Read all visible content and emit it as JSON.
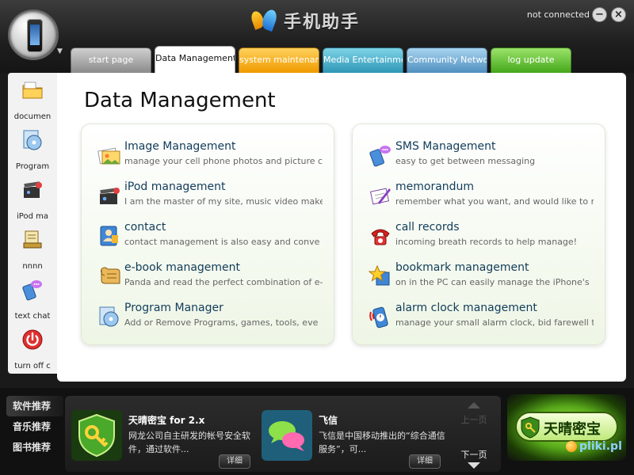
{
  "header": {
    "app_title": "手机助手",
    "connection_status": "not connected",
    "minimize_label": "−",
    "close_label": "×"
  },
  "tabs": [
    {
      "label": "start page"
    },
    {
      "label": "Data Management"
    },
    {
      "label": "system maintenance"
    },
    {
      "label": "Media Entertainment"
    },
    {
      "label": "Community Network"
    },
    {
      "label": "log update"
    }
  ],
  "sidebar": {
    "items": [
      {
        "label": "documen",
        "icon": "folder-icon"
      },
      {
        "label": "Program",
        "icon": "program-disc-icon"
      },
      {
        "label": "iPod ma",
        "icon": "clapperboard-icon"
      },
      {
        "label": "nnnn",
        "icon": "book-stack-icon"
      },
      {
        "label": "text chat",
        "icon": "chat-bubble-icon"
      },
      {
        "label": "turn off c",
        "icon": "power-icon"
      }
    ]
  },
  "main": {
    "title": "Data Management",
    "left_group": [
      {
        "title": "Image Management",
        "desc": "manage your cell phone photos and picture c",
        "icon": "photos-icon"
      },
      {
        "title": "iPod management",
        "desc": "I am the master of my site, music video make",
        "icon": "clapperboard-icon"
      },
      {
        "title": "contact",
        "desc": "contact management is also easy and conve",
        "icon": "contact-card-icon"
      },
      {
        "title": "e-book management",
        "desc": "Panda and read the perfect combination of e-",
        "icon": "scroll-book-icon"
      },
      {
        "title": "Program Manager",
        "desc": "Add or Remove Programs, games, tools, eve",
        "icon": "program-disc-icon"
      }
    ],
    "right_group": [
      {
        "title": "SMS Management",
        "desc": "easy to get between messaging",
        "icon": "sms-phone-icon"
      },
      {
        "title": "memorandum",
        "desc": "remember what you want, and would like to r",
        "icon": "memo-pen-icon"
      },
      {
        "title": "call records",
        "desc": "incoming breath records to help manage!",
        "icon": "red-telephone-icon"
      },
      {
        "title": "bookmark management",
        "desc": "on in the PC can easily manage the iPhone's",
        "icon": "star-bookmark-icon"
      },
      {
        "title": "alarm clock management",
        "desc": "manage your small alarm clock, bid farewell t",
        "icon": "alarm-clock-icon"
      }
    ]
  },
  "bottom": {
    "categories": [
      "软件推荐",
      "音乐推荐",
      "图书推荐"
    ],
    "promos": [
      {
        "title": "天晴密宝 for 2.x",
        "desc": "网龙公司自主研发的帐号安全软件，通过软件...",
        "more": "详细"
      },
      {
        "title": "飞信",
        "desc": "飞信是中国移动推出的“综合通信服务”，可...",
        "more": "详细"
      }
    ],
    "pager": {
      "prev": "上一页",
      "next": "下一页"
    },
    "banner_text": "天晴密宝",
    "watermark": "pliki.pl"
  }
}
